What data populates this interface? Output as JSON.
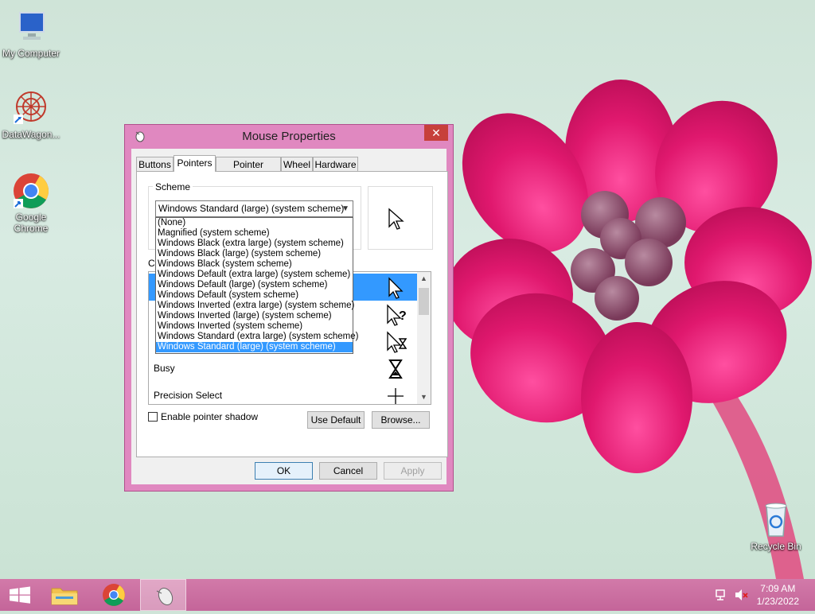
{
  "desktop": {
    "icons": [
      {
        "label": "My Computer"
      },
      {
        "label": "DataWagon..."
      },
      {
        "label": "Google Chrome"
      },
      {
        "label": "Recycle Bin"
      }
    ]
  },
  "dialog": {
    "title": "Mouse Properties",
    "close_glyph": "✕",
    "tabs": [
      {
        "label": "Buttons"
      },
      {
        "label": "Pointers"
      },
      {
        "label": "Pointer Options"
      },
      {
        "label": "Wheel"
      },
      {
        "label": "Hardware"
      }
    ],
    "active_tab": "Pointers",
    "scheme": {
      "label": "Scheme",
      "selected": "Windows Standard (large) (system scheme)",
      "options": [
        "(None)",
        "Magnified (system scheme)",
        "Windows Black (extra large) (system scheme)",
        "Windows Black (large) (system scheme)",
        "Windows Black (system scheme)",
        "Windows Default (extra large) (system scheme)",
        "Windows Default (large) (system scheme)",
        "Windows Default (system scheme)",
        "Windows Inverted (extra large) (system scheme)",
        "Windows Inverted (large) (system scheme)",
        "Windows Inverted (system scheme)",
        "Windows Standard (extra large) (system scheme)",
        "Windows Standard (large) (system scheme)"
      ]
    },
    "customize_label_partial": "Cu",
    "cursor_rows": [
      {
        "label": "",
        "icon": "arrow-cursor-icon"
      },
      {
        "label": "",
        "icon": "help-select-cursor-icon"
      },
      {
        "label": "",
        "icon": "working-in-background-cursor-icon"
      },
      {
        "label": "Busy",
        "icon": "hourglass-cursor-icon"
      },
      {
        "label": "Precision Select",
        "icon": "crosshair-cursor-icon"
      }
    ],
    "enable_shadow_label": "Enable pointer shadow",
    "use_default_label": "Use Default",
    "browse_label": "Browse...",
    "ok_label": "OK",
    "cancel_label": "Cancel",
    "apply_label": "Apply"
  },
  "taskbar": {
    "time": "7:09 AM",
    "date": "1/23/2022"
  },
  "colors": {
    "accent": "#3399ff",
    "window_frame": "#e088c0",
    "taskbar": "#c56b9c"
  }
}
